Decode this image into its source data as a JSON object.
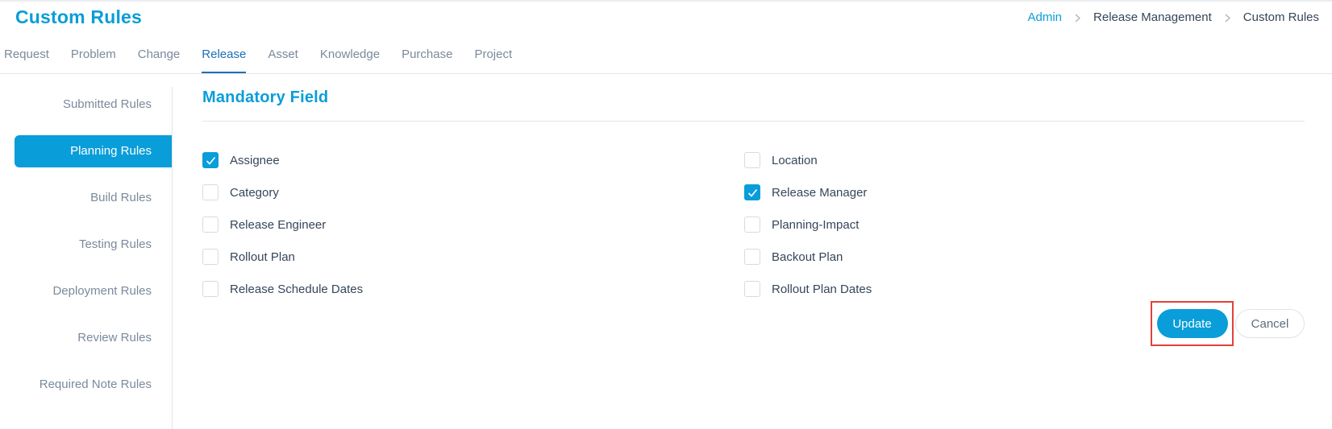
{
  "header": {
    "title": "Custom Rules",
    "breadcrumb": [
      {
        "label": "Admin",
        "link": true
      },
      {
        "label": "Release Management",
        "link": false
      },
      {
        "label": "Custom Rules",
        "link": false
      }
    ]
  },
  "tabs": [
    {
      "label": "Request",
      "active": false
    },
    {
      "label": "Problem",
      "active": false
    },
    {
      "label": "Change",
      "active": false
    },
    {
      "label": "Release",
      "active": true
    },
    {
      "label": "Asset",
      "active": false
    },
    {
      "label": "Knowledge",
      "active": false
    },
    {
      "label": "Purchase",
      "active": false
    },
    {
      "label": "Project",
      "active": false
    }
  ],
  "sidebar": {
    "items": [
      {
        "label": "Submitted Rules",
        "active": false
      },
      {
        "label": "Planning Rules",
        "active": true
      },
      {
        "label": "Build Rules",
        "active": false
      },
      {
        "label": "Testing Rules",
        "active": false
      },
      {
        "label": "Deployment Rules",
        "active": false
      },
      {
        "label": "Review Rules",
        "active": false
      },
      {
        "label": "Required Note Rules",
        "active": false
      }
    ]
  },
  "main": {
    "section_title": "Mandatory Field",
    "fields_left": [
      {
        "label": "Assignee",
        "checked": true
      },
      {
        "label": "Category",
        "checked": false
      },
      {
        "label": "Release Engineer",
        "checked": false
      },
      {
        "label": "Rollout Plan",
        "checked": false
      },
      {
        "label": "Release Schedule Dates",
        "checked": false
      }
    ],
    "fields_right": [
      {
        "label": "Location",
        "checked": false
      },
      {
        "label": "Release Manager",
        "checked": true
      },
      {
        "label": "Planning-Impact",
        "checked": false
      },
      {
        "label": "Backout Plan",
        "checked": false
      },
      {
        "label": "Rollout Plan Dates",
        "checked": false
      }
    ],
    "actions": {
      "update_label": "Update",
      "cancel_label": "Cancel"
    }
  },
  "colors": {
    "accent": "#099dd9",
    "active_tab": "#1d6fb8",
    "highlight_box": "#e0413b"
  },
  "icons": {
    "breadcrumb_separator": "chevron-right-icon",
    "checkbox_mark": "check-icon"
  }
}
